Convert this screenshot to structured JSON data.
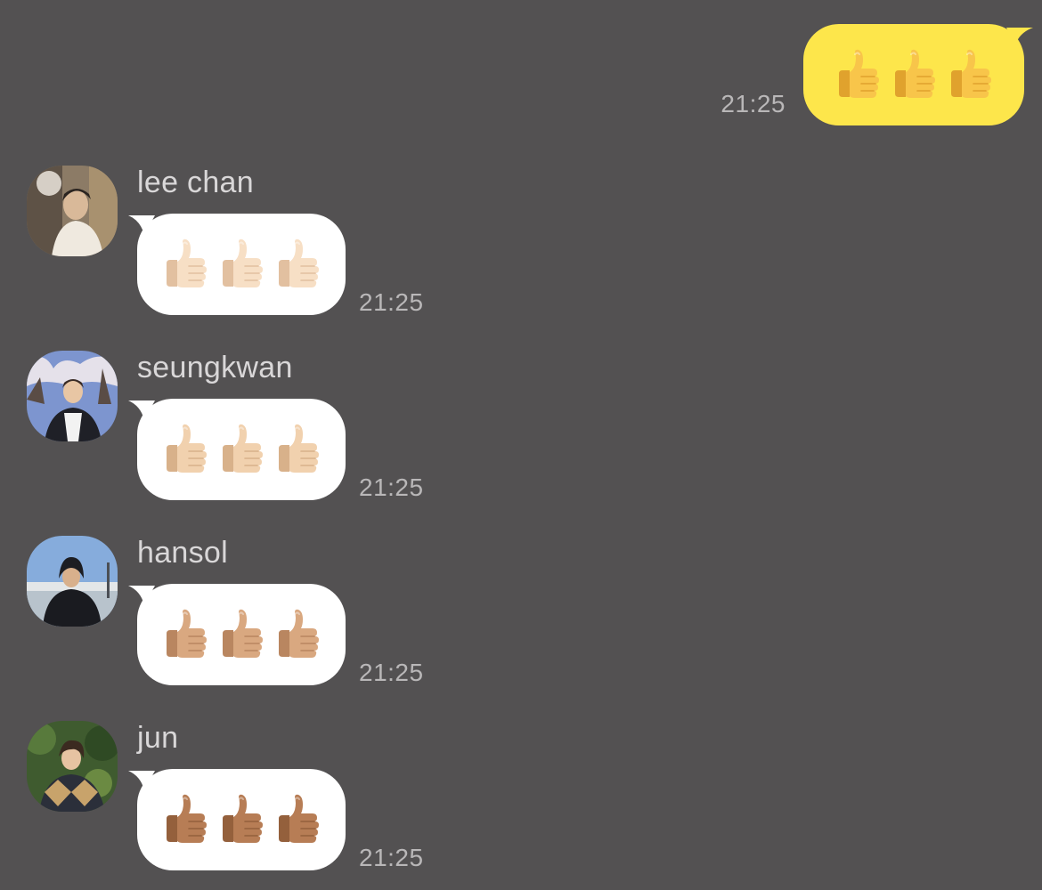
{
  "outgoing": {
    "time": "21:25",
    "emoji_count": 3,
    "bubble_color": "#fde64b",
    "skin_tone": {
      "base": "#f8c54a",
      "shade": "#e0a22d"
    }
  },
  "messages": [
    {
      "sender": "lee chan",
      "time": "21:25",
      "emoji_count": 3,
      "skin_tone": {
        "base": "#f7dfc5",
        "shade": "#e2c0a0"
      },
      "avatar_colors": [
        "#7a6a58",
        "#c8b9a2",
        "#e9e4dc"
      ]
    },
    {
      "sender": "seungkwan",
      "time": "21:25",
      "emoji_count": 3,
      "skin_tone": {
        "base": "#f1d1ae",
        "shade": "#d8b18a"
      },
      "avatar_colors": [
        "#6f86c4",
        "#d9d6e3",
        "#2a2a30"
      ]
    },
    {
      "sender": "hansol",
      "time": "21:25",
      "emoji_count": 3,
      "skin_tone": {
        "base": "#d9a880",
        "shade": "#b98660"
      },
      "avatar_colors": [
        "#7ea6d8",
        "#cfd8e2",
        "#1e1f24"
      ]
    },
    {
      "sender": "jun",
      "time": "21:25",
      "emoji_count": 3,
      "skin_tone": {
        "base": "#b77d55",
        "shade": "#94603c"
      },
      "avatar_colors": [
        "#3d5a2e",
        "#c7a36b",
        "#2b2b2b"
      ]
    }
  ],
  "colors": {
    "background": "#535152",
    "incoming_bubble": "#ffffff",
    "time_text": "#b9b7b8",
    "sender_text": "#d9d7d8"
  },
  "icons": {
    "emoji": "thumbs-up-icon",
    "avatar": "profile-photo"
  }
}
